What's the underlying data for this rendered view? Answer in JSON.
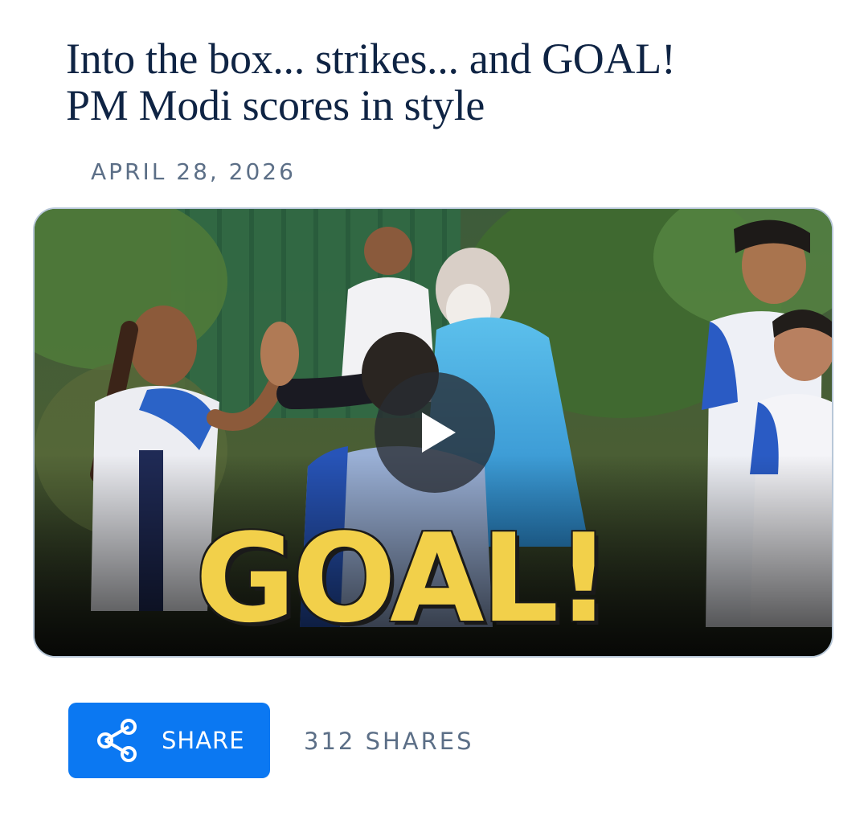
{
  "article": {
    "headline_line1": "Into the box... strikes... and GOAL!",
    "headline_line2": "PM Modi scores in style",
    "date": "APRIL 28, 2026"
  },
  "video": {
    "overlay_text": "GOAL!",
    "play_icon": "play-icon"
  },
  "share": {
    "button_label": "SHARE",
    "button_icon": "share-icon",
    "count_text": "312 SHARES"
  },
  "colors": {
    "headline": "#0f2444",
    "meta": "#5c6f87",
    "share_button": "#0b78f2",
    "goal_yellow": "#f2d04a"
  }
}
